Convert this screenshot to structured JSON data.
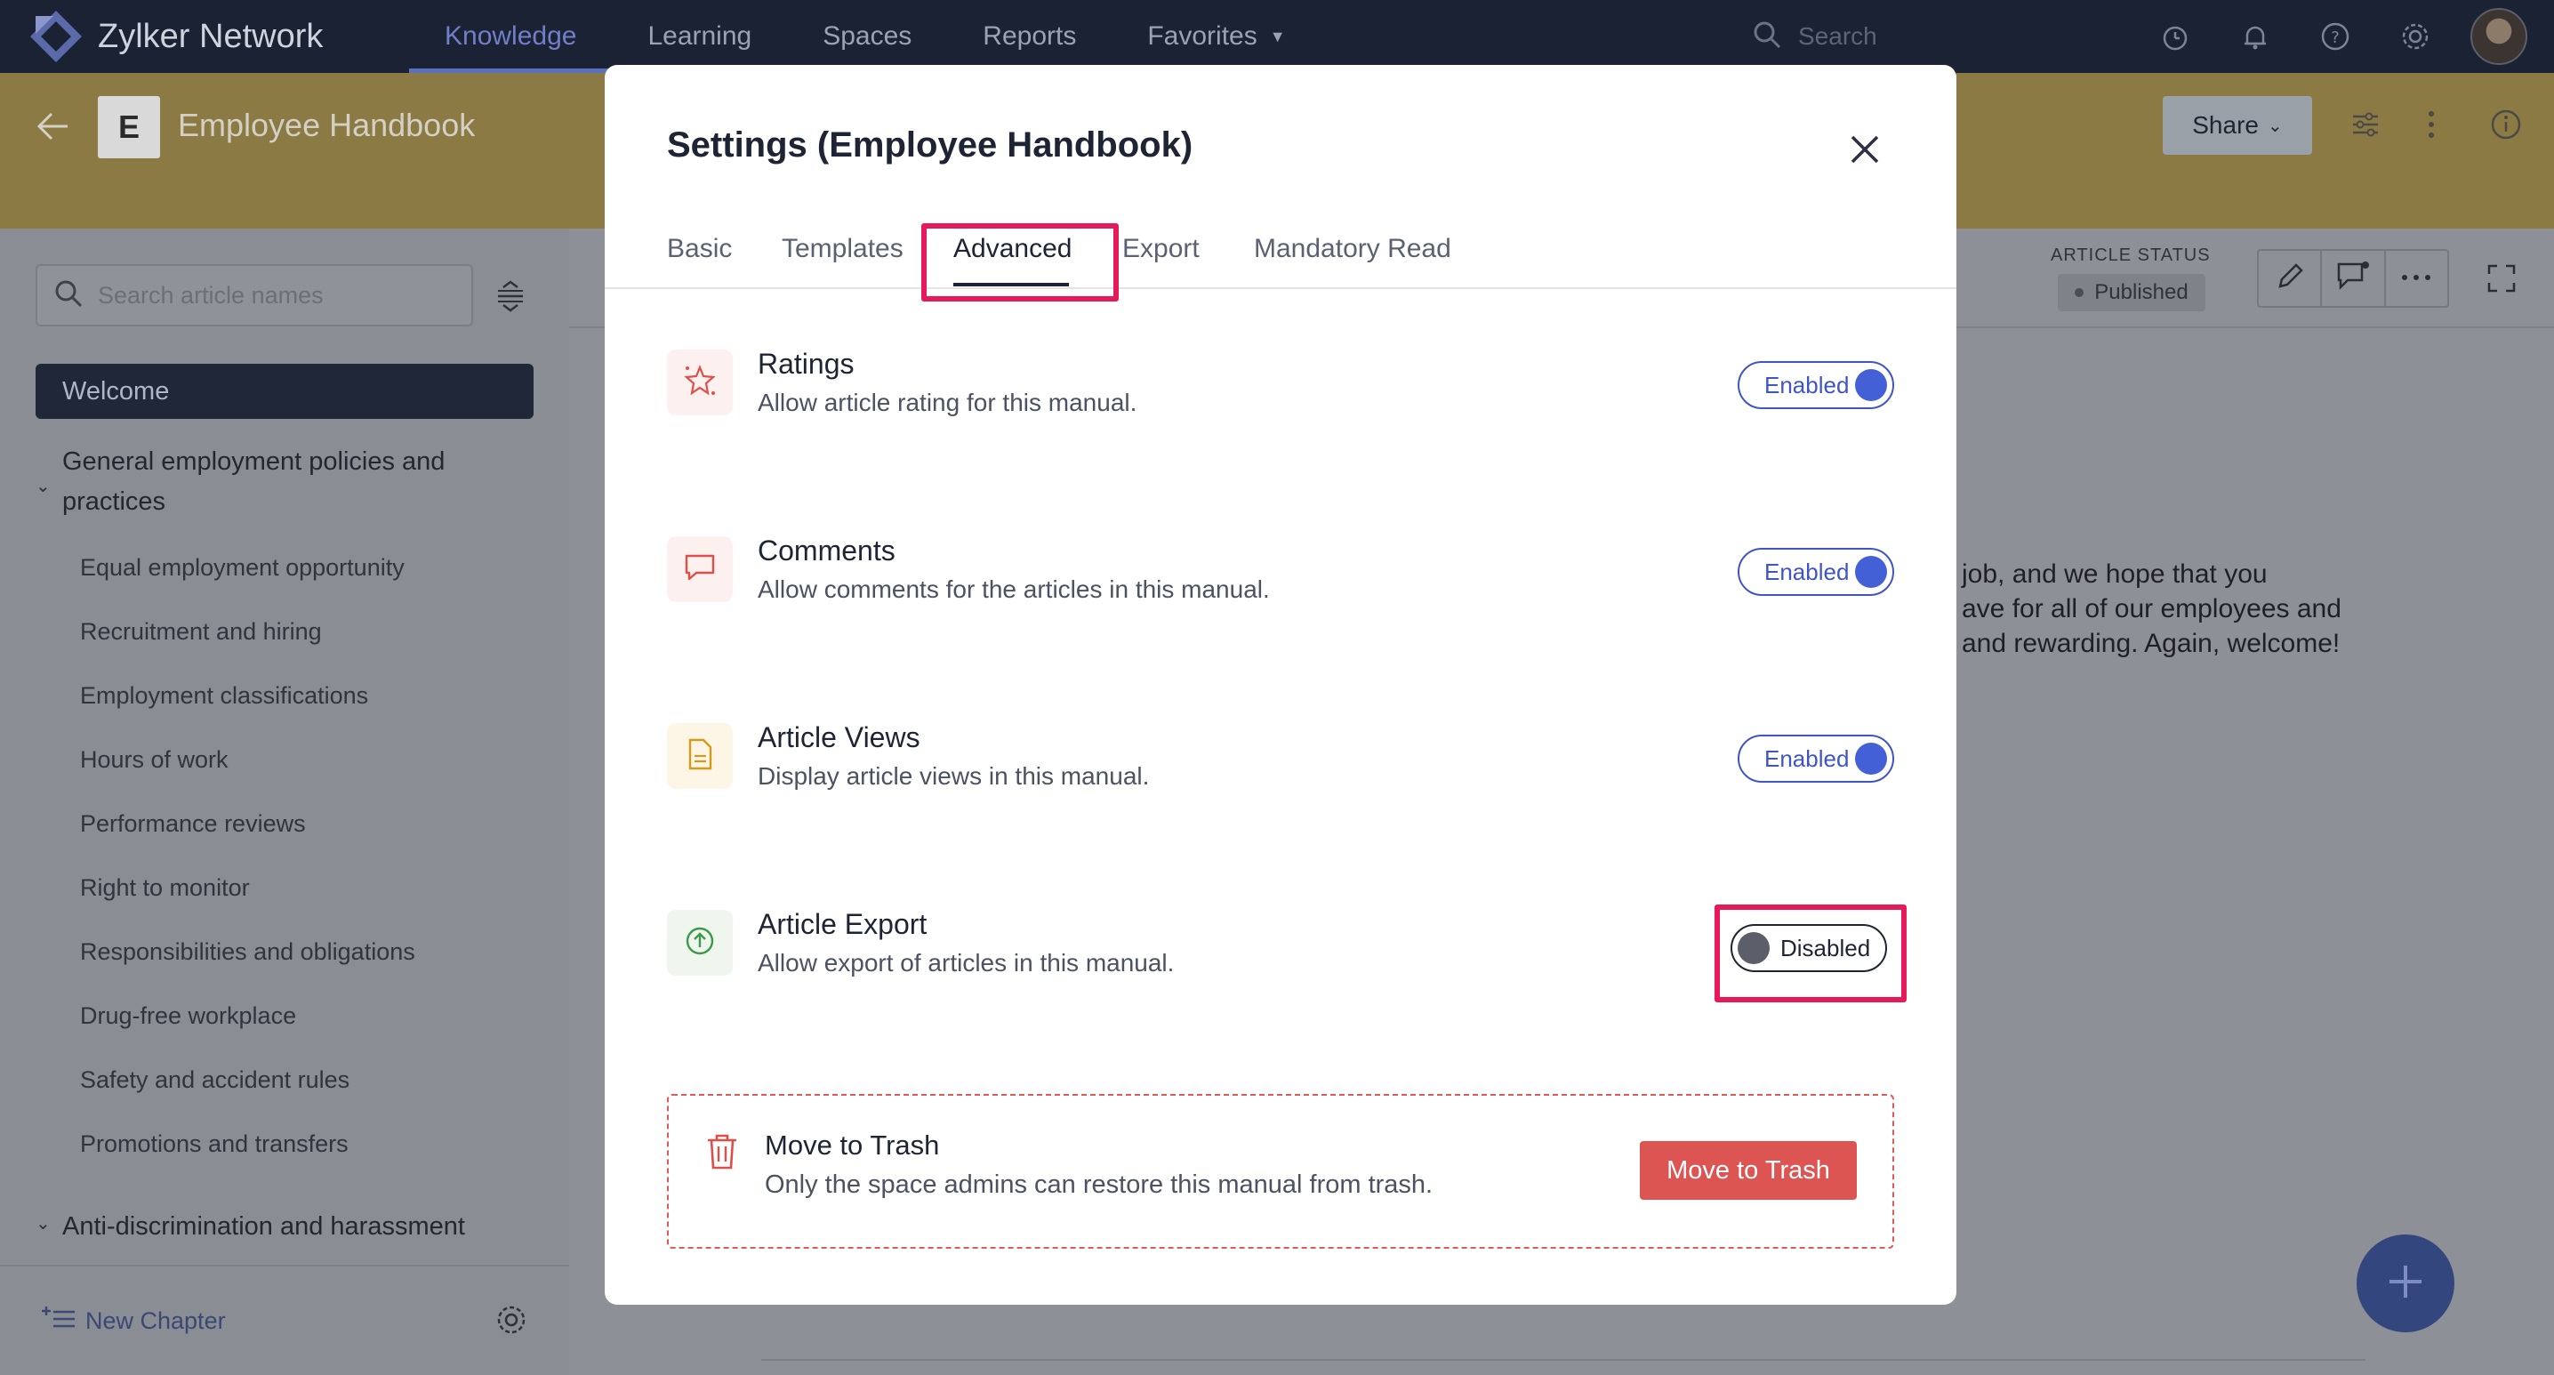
{
  "topnav": {
    "brand": "Zylker Network",
    "tabs": [
      {
        "label": "Knowledge"
      },
      {
        "label": "Learning"
      },
      {
        "label": "Spaces"
      },
      {
        "label": "Reports"
      },
      {
        "label": "Favorites"
      }
    ],
    "search_placeholder": "Search"
  },
  "space": {
    "badge": "E",
    "title": "Employee Handbook",
    "share_label": "Share"
  },
  "sidebar": {
    "search_placeholder": "Search article names",
    "welcome": "Welcome",
    "chapter1": "General employment policies and practices",
    "items": [
      "Equal employment opportunity",
      "Recruitment and hiring",
      "Employment classifications",
      "Hours of work",
      "Performance reviews",
      "Right to monitor",
      "Responsibilities and obligations",
      "Drug-free workplace",
      "Safety and accident rules",
      "Promotions and transfers"
    ],
    "chapter2": "Anti-discrimination and harassment",
    "new_chapter": "New Chapter"
  },
  "article": {
    "status_label": "ARTICLE STATUS",
    "status_value": "Published",
    "body_lines": [
      " job, and we hope that you",
      "ave for all of our employees and",
      " and rewarding. Again, welcome!"
    ]
  },
  "modal": {
    "title": "Settings (Employee Handbook)",
    "tabs": [
      "Basic",
      "Templates",
      "Advanced",
      "Export",
      "Mandatory Read"
    ],
    "active_tab": "Advanced",
    "settings": [
      {
        "title": "Ratings",
        "desc": "Allow article rating for this manual.",
        "state": "Enabled"
      },
      {
        "title": "Comments",
        "desc": "Allow comments for the articles in this manual.",
        "state": "Enabled"
      },
      {
        "title": "Article Views",
        "desc": "Display article views in this manual.",
        "state": "Enabled"
      },
      {
        "title": "Article Export",
        "desc": "Allow export of articles in this manual.",
        "state": "Disabled"
      }
    ],
    "trash": {
      "title": "Move to Trash",
      "desc": "Only the space admins can restore this manual from trash.",
      "button": "Move to Trash"
    }
  },
  "colors": {
    "nav_bg": "#1b2234",
    "accent": "#4360d6",
    "danger": "#dd5552",
    "highlight": "#e6195a"
  }
}
